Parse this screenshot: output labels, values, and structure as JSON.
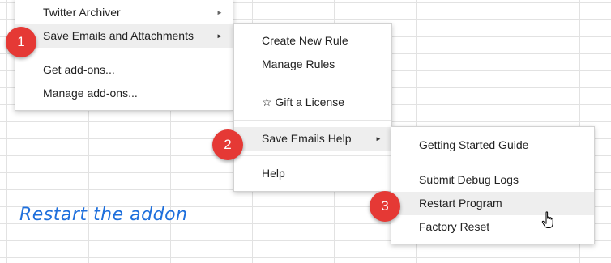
{
  "menu1": {
    "items": [
      {
        "label": "Twitter Archiver"
      },
      {
        "label": "Save Emails and Attachments"
      },
      {
        "label": "Get add-ons..."
      },
      {
        "label": "Manage add-ons..."
      }
    ],
    "arrow": "►"
  },
  "menu2": {
    "items": [
      {
        "label": "Create New Rule"
      },
      {
        "label": "Manage Rules"
      },
      {
        "label": "☆ Gift a License"
      },
      {
        "label": "Save Emails Help"
      },
      {
        "label": "Help"
      }
    ],
    "arrow": "►"
  },
  "menu3": {
    "items": [
      {
        "label": "Getting Started Guide"
      },
      {
        "label": "Submit Debug Logs"
      },
      {
        "label": "Restart Program"
      },
      {
        "label": "Factory Reset"
      }
    ]
  },
  "badges": [
    "1",
    "2",
    "3"
  ],
  "caption": "Restart the addon",
  "colors": {
    "badge": "#e53935",
    "caption": "#1e6fdc",
    "hover": "#eeeeee"
  },
  "cursor_icon": "hand-pointer-icon"
}
